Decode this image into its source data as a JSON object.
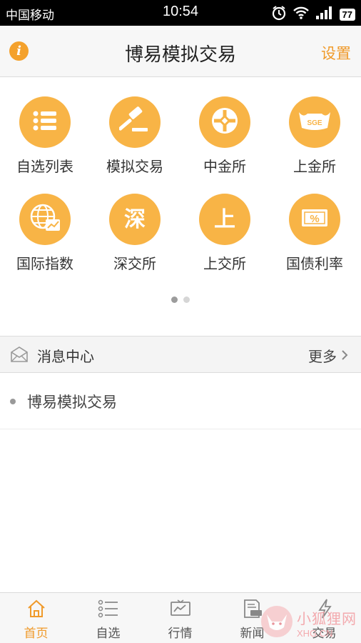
{
  "status_bar": {
    "carrier": "中国移动",
    "time": "10:54",
    "battery": "77"
  },
  "header": {
    "title": "博易模拟交易",
    "settings_label": "设置",
    "info_glyph": "i"
  },
  "grid": {
    "items": [
      {
        "label": "自选列表",
        "icon": "list-icon"
      },
      {
        "label": "模拟交易",
        "icon": "gavel-icon"
      },
      {
        "label": "中金所",
        "icon": "cfe-emblem-icon"
      },
      {
        "label": "上金所",
        "icon": "sge-ingot-icon",
        "icon_text": "SGE"
      },
      {
        "label": "国际指数",
        "icon": "globe-chart-icon"
      },
      {
        "label": "深交所",
        "icon": "shen-character-icon",
        "icon_text": "深"
      },
      {
        "label": "上交所",
        "icon": "shang-character-icon",
        "icon_text": "上"
      },
      {
        "label": "国债利率",
        "icon": "percent-ticket-icon",
        "icon_text": "%"
      }
    ],
    "page_indicator": {
      "pages": 2,
      "current": 1
    }
  },
  "messages": {
    "title": "消息中心",
    "more_label": "更多",
    "items": [
      {
        "text": "博易模拟交易"
      }
    ]
  },
  "tabbar": {
    "tabs": [
      {
        "label": "首页",
        "icon": "home-icon",
        "active": true
      },
      {
        "label": "自选",
        "icon": "list-icon",
        "active": false
      },
      {
        "label": "行情",
        "icon": "chart-monitor-icon",
        "active": false
      },
      {
        "label": "新闻",
        "icon": "news-icon",
        "active": false
      },
      {
        "label": "交易",
        "icon": "lightning-icon",
        "active": false
      }
    ]
  },
  "watermark": {
    "text_cn": "小狐狸网",
    "text_en": "XHG.CN"
  },
  "colors": {
    "accent": "#f09a2a",
    "icon_circle": "#f8b446",
    "status_bar_bg": "#000000",
    "watermark": "#f3a2a7"
  }
}
